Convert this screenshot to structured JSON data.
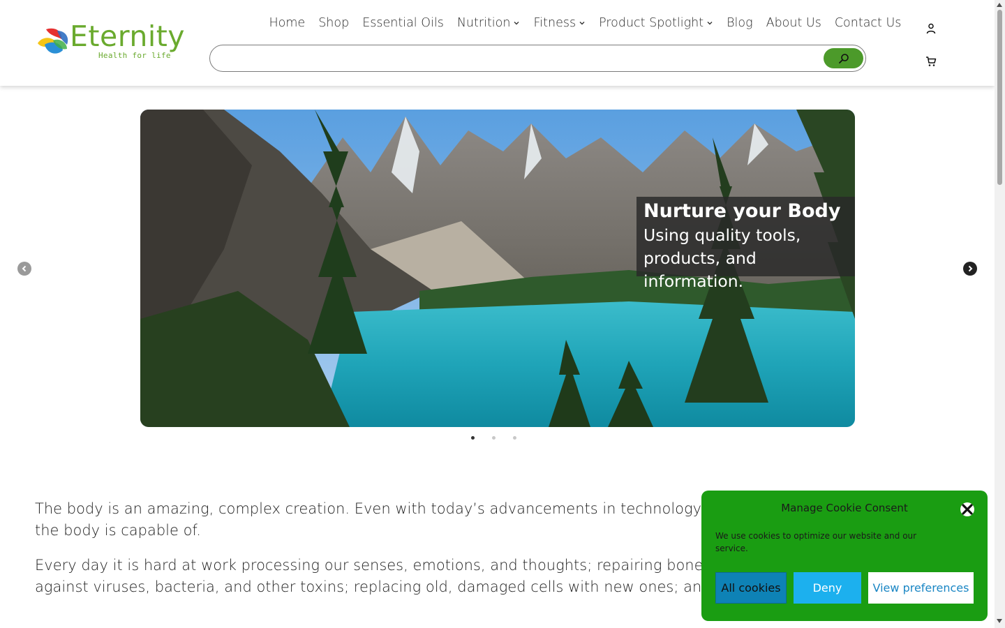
{
  "brand": {
    "name": "Eternity",
    "tagline": "Health for life"
  },
  "nav": {
    "items": [
      {
        "label": "Home",
        "dropdown": false
      },
      {
        "label": "Shop",
        "dropdown": false
      },
      {
        "label": "Essential Oils",
        "dropdown": false
      },
      {
        "label": "Nutrition",
        "dropdown": true
      },
      {
        "label": "Fitness",
        "dropdown": true
      },
      {
        "label": "Product Spotlight",
        "dropdown": true
      },
      {
        "label": "Blog",
        "dropdown": false
      },
      {
        "label": "About Us",
        "dropdown": false
      },
      {
        "label": "Contact Us",
        "dropdown": false
      }
    ]
  },
  "search": {
    "value": "",
    "placeholder": "",
    "button_icon": "search-icon"
  },
  "header_icons": {
    "account": "user-icon",
    "cart": "cart-icon"
  },
  "slider": {
    "caption_title": "Nurture your Body",
    "caption_line1": "Using quality tools,",
    "caption_line2": "products, and information.",
    "slide_count": 3,
    "active_slide": 1
  },
  "content": {
    "para1": "The body is an amazing, complex creation. Even with today’s advancements in technology, we have yet to fully understand the body is capable of.",
    "para2": "Every day it is hard at work processing our senses, emotions, and thoughts; repairing bones, tissues, and organs; defending against viruses, bacteria, and other toxins; replacing old, damaged cells with new ones; and making new neurons (nerve cells)."
  },
  "cookie": {
    "title": "Manage Cookie Consent",
    "message": "We use cookies to optimize our website and our service.",
    "accept_label": "All cookies",
    "deny_label": "Deny",
    "prefs_label": "View preferences"
  },
  "colors": {
    "brand_green": "#6aaa2e",
    "search_button": "#4c9a2a",
    "cookie_bg": "#1a9d12",
    "accept_bg": "#0e82b6",
    "deny_bg": "#1cb0ee"
  }
}
